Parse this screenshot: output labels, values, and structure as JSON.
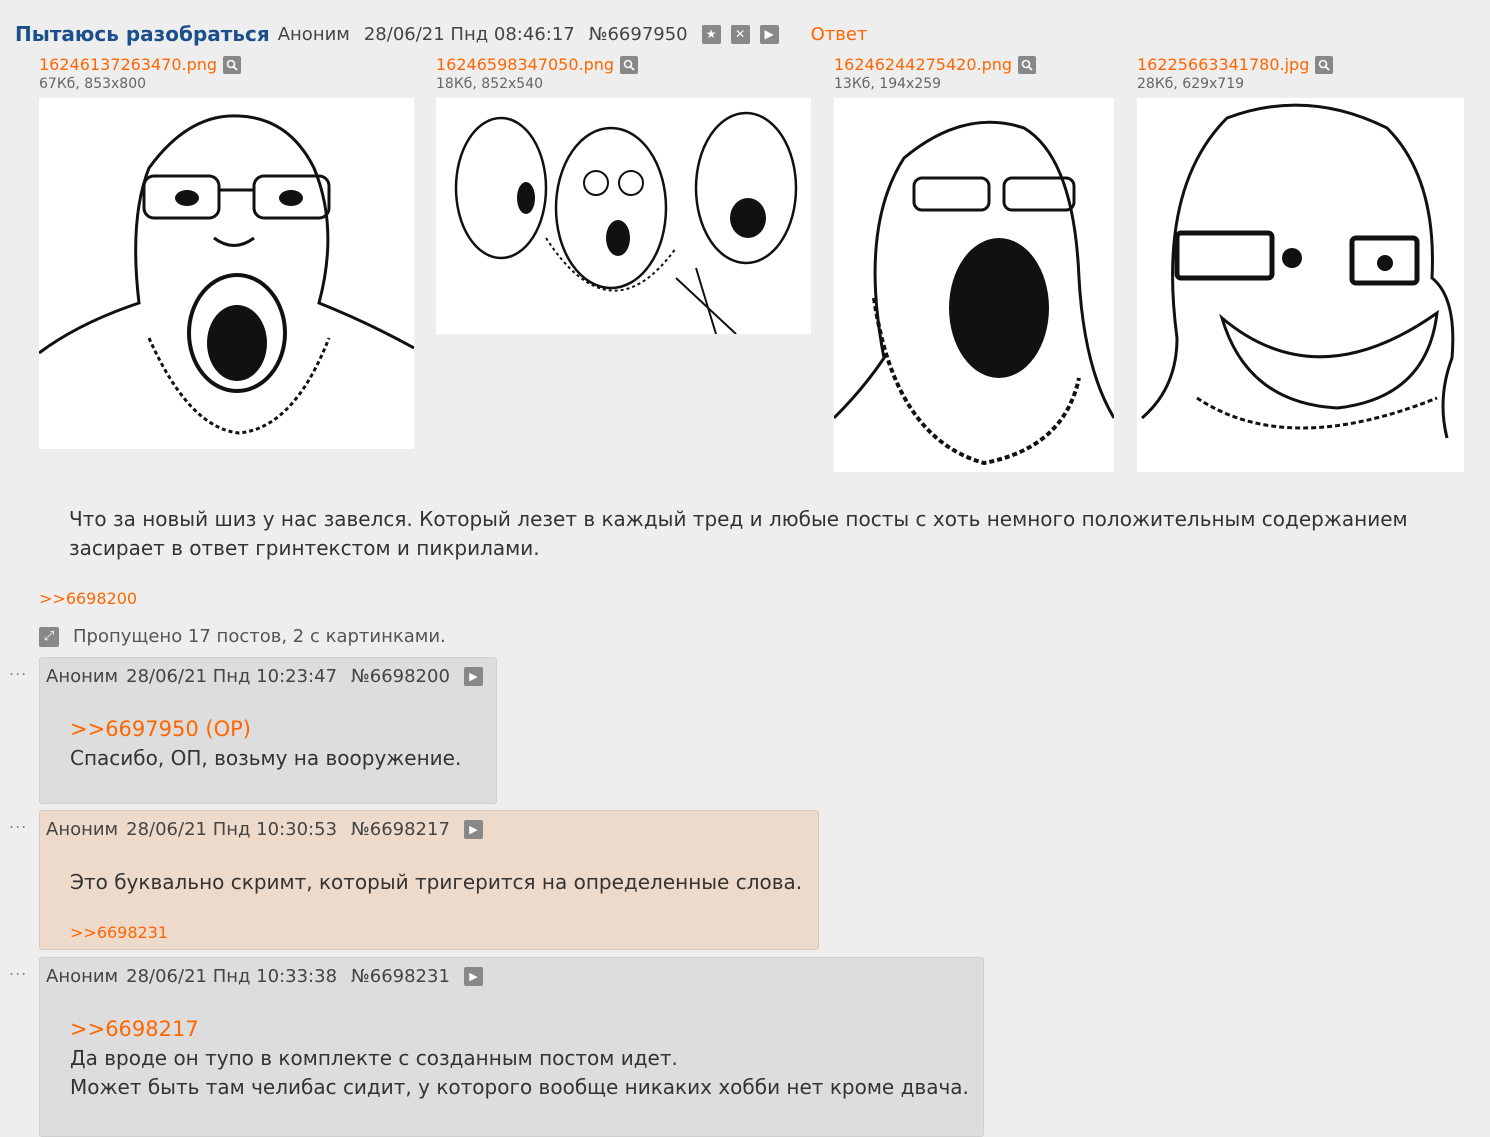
{
  "op": {
    "title": "Пытаюсь разобраться",
    "author": "Аноним",
    "datetime": "28/06/21 Пнд 08:46:17",
    "number": "№6697950",
    "reply_label": "Ответ",
    "files": [
      {
        "name": "16246137263470.png",
        "meta": "67Кб, 853x800"
      },
      {
        "name": "16246598347050.png",
        "meta": "18Кб, 852x540"
      },
      {
        "name": "16246244275420.png",
        "meta": "13Кб, 194x259"
      },
      {
        "name": "16225663341780.jpg",
        "meta": "28Кб, 629x719"
      }
    ],
    "body": "Что за новый шиз у нас завелся. Который лезет в каждый тред и любые посты с хоть немного положительным содержанием засирает в ответ гринтекстом и пикрилами.",
    "backlink": ">>6698200"
  },
  "omitted_text": "Пропущено 17 постов, 2 с картинками.",
  "posts": [
    {
      "author": "Аноним",
      "datetime": "28/06/21 Пнд 10:23:47",
      "number": "№6698200",
      "quote": ">>6697950 (OP)",
      "lines": [
        "Спасибо, ОП, возьму на вооружение."
      ]
    },
    {
      "author": "Аноним",
      "datetime": "28/06/21 Пнд 10:30:53",
      "number": "№6698217",
      "lines": [
        "Это буквально скримт, который тригерится на определенные слова."
      ],
      "backlink": ">>6698231"
    },
    {
      "author": "Аноним",
      "datetime": "28/06/21 Пнд 10:33:38",
      "number": "№6698231",
      "quote": ">>6698217",
      "lines": [
        "Да вроде он тупо в комплекте с созданным постом идет.",
        "Может быть там челибас сидит, у которого вообще никаких хобби нет кроме двача."
      ]
    }
  ],
  "dots": "...",
  "colors": {
    "link": "#ff6600",
    "title": "#1a4f8b",
    "post_bg": "#dddddd",
    "post_highlight_bg": "#eedacb",
    "page_bg": "#eeeeee"
  }
}
